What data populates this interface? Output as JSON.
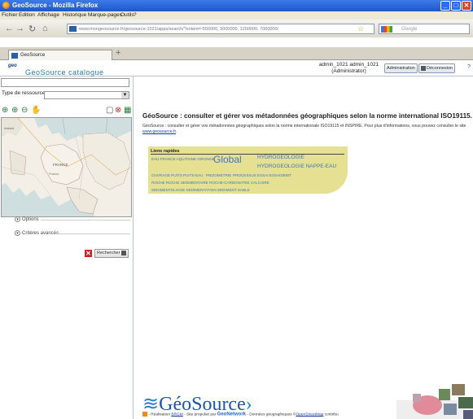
{
  "window": {
    "title": "GeoSource - Mozilla Firefox",
    "min": "_",
    "max": "□",
    "close": "✕"
  },
  "menu": [
    "Fichier",
    "Edition",
    "Affichage",
    "Historique",
    "Marque-pages",
    "Outils",
    "?"
  ],
  "nav": {
    "url": "www.mongeosource.fr/geosource-1021/apps/search/?extent=-550000, 5000000, 1200000, 7000000/",
    "search_placeholder": "Google"
  },
  "tabs": [
    {
      "label": "GeoSource"
    }
  ],
  "header": {
    "logo_text": "geo",
    "catalog_title": "GeoSource catalogue",
    "user_name": "admin_1021 admin_1021",
    "user_role": "(Administrator)",
    "admin_button": "Administration",
    "logout_button": "Déconnexion",
    "help": "?"
  },
  "sidebar": {
    "type_label": "Type de ressource:",
    "options_label": "Options",
    "advanced_label": "Critères avancés",
    "search_button": "Rechercher",
    "map_labels": {
      "france": "FRANCE",
      "fr2": "France",
      "ireland": "Ireland"
    }
  },
  "main": {
    "title": "GéoSource : consulter et gérer vos métadonnées géographiques selon la norme international ISO19115.",
    "desc": "GéoSource : consulter et gérer vos métadonnées géographiques selon la norme internationale ISO19115 et INSPIRE. Pour plus d'informations, vous pouvez consulter le site",
    "desc_link": "www.geosource.fr",
    "quick_title": "Liens rapides",
    "keywords": [
      "EAU FRANCE AQUITAINE GIRONDE",
      "Global",
      "HYDROGEOLOGIE",
      "HYDROGEOLOGIE NAPPE-EAU",
      "OUVRAGE PUITS PUITS-EAU",
      "PIEZOMETRIE",
      "PROCESSUS ESSAI ESSAIDEBIT",
      "ROCHE ROCHE SEDIMENTAIRE ROCHE-CARBONATEE CALCAIRE",
      "SEDIMENTOLOGIE SEDIMENTATION SEDIMENT SABLE"
    ]
  },
  "footer": {
    "logo": "GéoSource",
    "text1": "- Réalisation",
    "brgm": "BRGM",
    "text2": "- Site propulsé par",
    "geonetwork": "GeoNetwork",
    "text3": "- Données géographiques ©",
    "osm": "OpenStreetMap",
    "text4": "contribu"
  },
  "colors": {
    "titlebar": "#2b62d6",
    "quick_links_bg": "#e6e192",
    "link": "#3b78b6",
    "title_blue": "#2a7ab0"
  }
}
